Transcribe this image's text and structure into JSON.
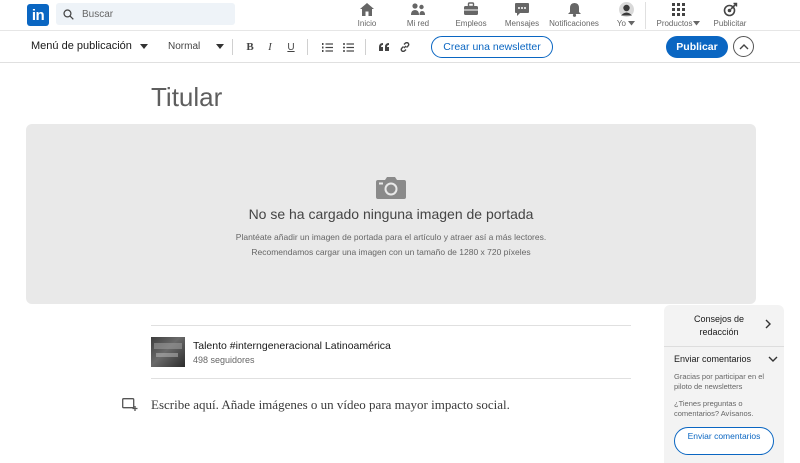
{
  "topnav": {
    "logo_text": "in",
    "search": {
      "placeholder": "Buscar"
    },
    "items": [
      {
        "label": "Inicio",
        "icon": "home-icon"
      },
      {
        "label": "Mi red",
        "icon": "network-icon"
      },
      {
        "label": "Empleos",
        "icon": "briefcase-icon"
      },
      {
        "label": "Mensajes",
        "icon": "messaging-icon"
      },
      {
        "label": "Notificaciones",
        "icon": "bell-icon"
      },
      {
        "label": "Yo",
        "icon": "avatar"
      },
      {
        "label": "Productos",
        "icon": "grid-icon"
      },
      {
        "label": "Publicitar",
        "icon": "advertise-icon"
      }
    ]
  },
  "toolbar": {
    "menu_label": "Menú de publicación",
    "text_style": "Normal",
    "bold": "B",
    "italic": "I",
    "underline": "U",
    "newsletter_button": "Crear una newsletter",
    "publish_button": "Publicar"
  },
  "article": {
    "headline": "Titular",
    "cover_title": "No se ha cargado ninguna imagen de portada",
    "cover_line1": "Plantéate añadir un imagen de portada para el artículo y atraer así a más lectores.",
    "cover_line2": "Recomendamos cargar una imagen con un tamaño de 1280 x 720 píxeles",
    "group_name": "Talento #interngeneracional Latinoamérica",
    "group_followers": "498 seguidores",
    "body_placeholder": "Escribe aquí. Añade imágenes o un vídeo para mayor impacto social."
  },
  "side_panel": {
    "tips_label": "Consejos de redacción",
    "feedback_header": "Enviar comentarios",
    "feedback_text1": "Gracias por participar en el piloto de newsletters",
    "feedback_text2": "¿Tienes preguntas o comentarios? Avísanos.",
    "feedback_button": "Enviar comentarios"
  },
  "colors": {
    "brand": "#0a66c2",
    "cover_bg": "#e9e9e9",
    "panel_bg": "#f3f3f3"
  }
}
